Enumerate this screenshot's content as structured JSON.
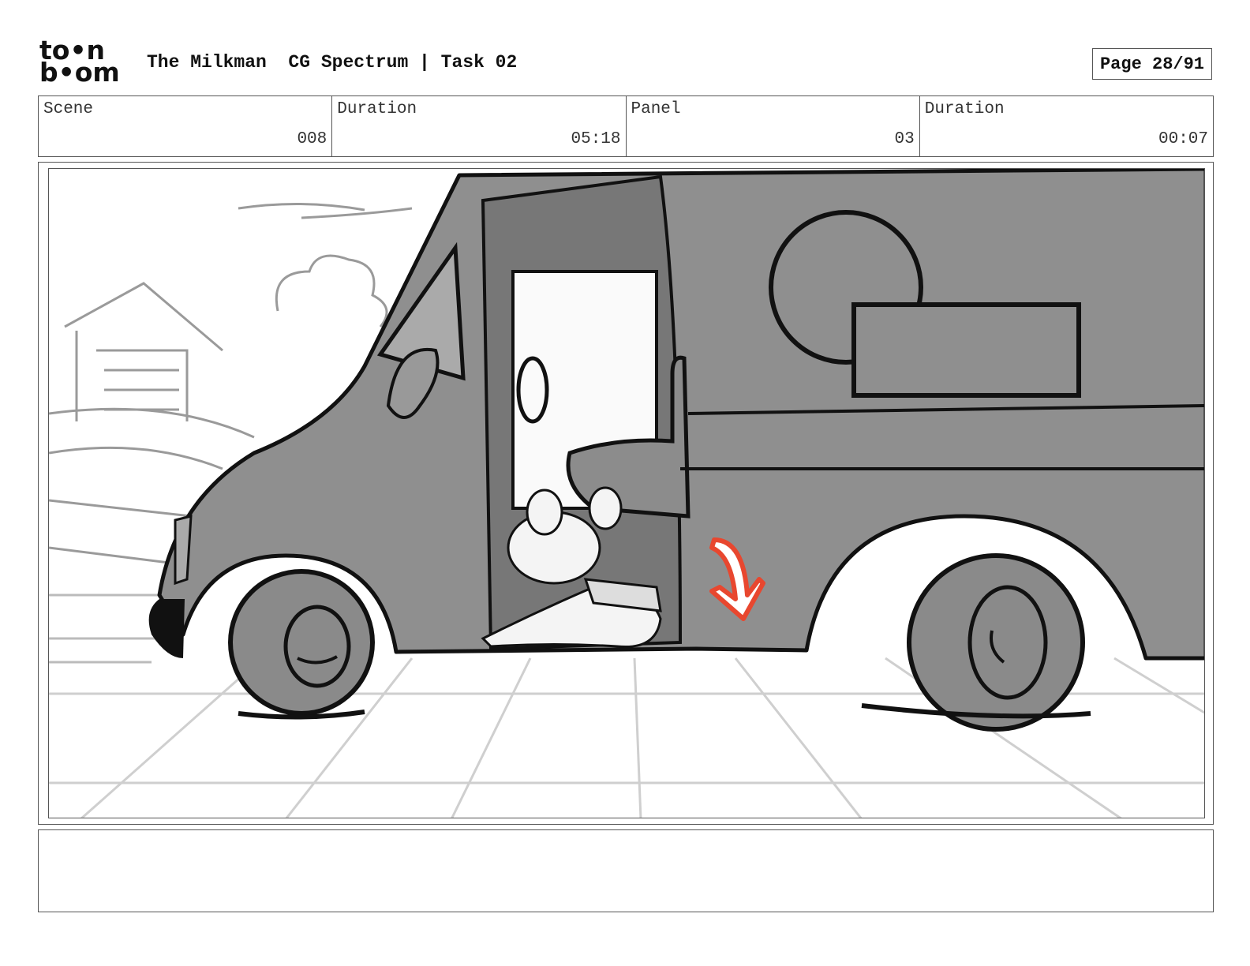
{
  "logo": {
    "line1": "to•n",
    "line2": "b•om"
  },
  "header": {
    "title": "The Milkman  CG Spectrum | Task 02",
    "page": "Page 28/91"
  },
  "info": [
    {
      "label": "Scene",
      "value": "008"
    },
    {
      "label": "Duration",
      "value": "05:18"
    },
    {
      "label": "Panel",
      "value": "03"
    },
    {
      "label": "Duration",
      "value": "00:07"
    }
  ],
  "notes": {
    "text": ""
  },
  "colors": {
    "van": "#8f8f8f",
    "arrow": "#e8472f",
    "ink": "#111111",
    "background": "#ffffff"
  }
}
